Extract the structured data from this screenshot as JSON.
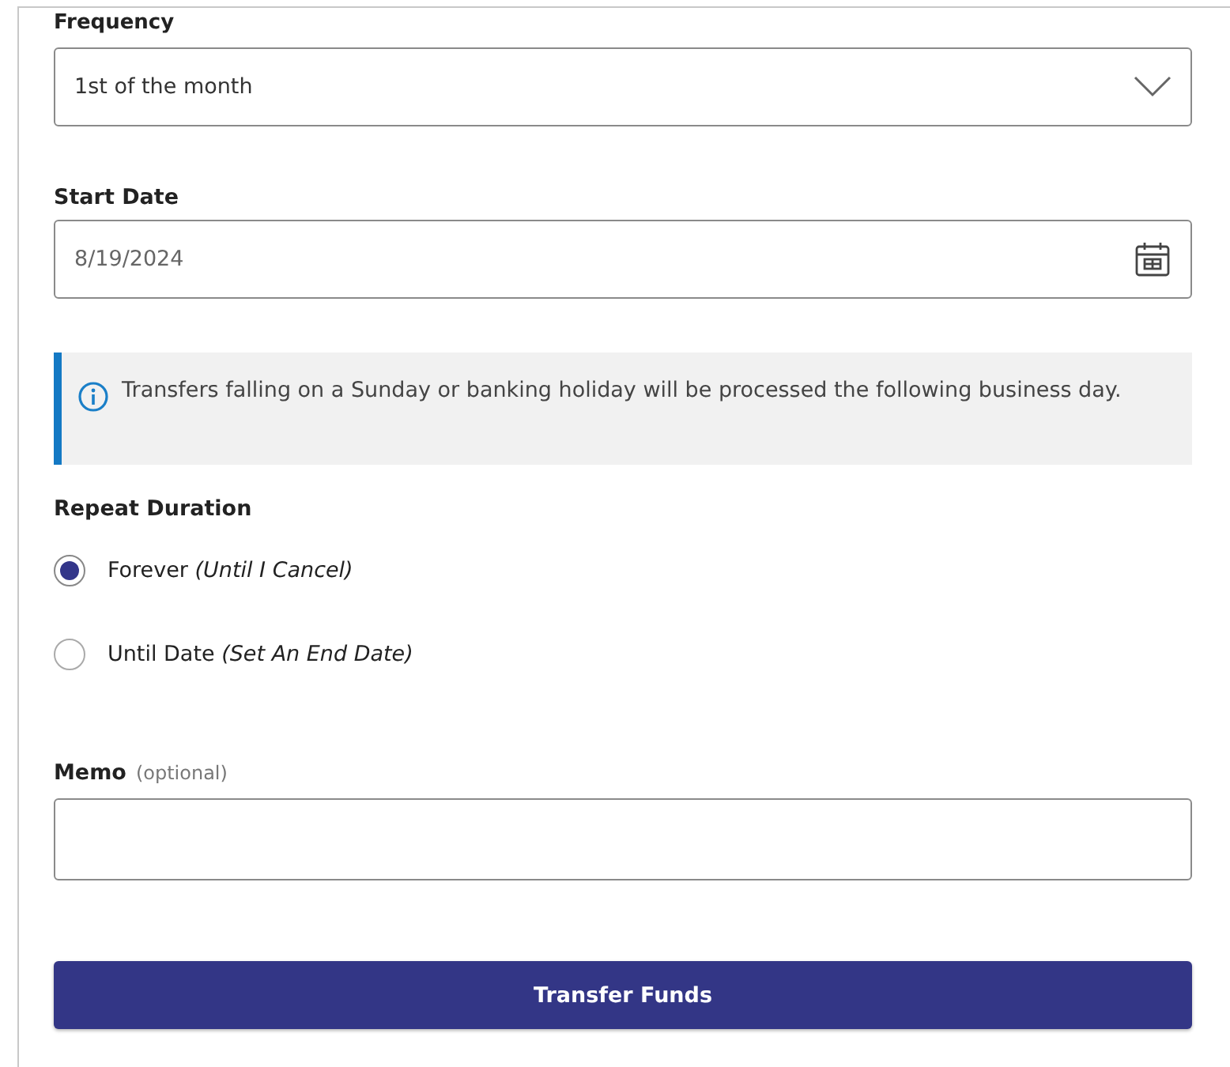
{
  "frequency": {
    "label": "Frequency",
    "value": "1st of the month"
  },
  "start_date": {
    "label": "Start Date",
    "value": "8/19/2024"
  },
  "notice": {
    "text": "Transfers falling on a Sunday or banking holiday will be processed the following business day."
  },
  "repeat_duration": {
    "label": "Repeat Duration",
    "options": [
      {
        "label": "Forever *(Until I Cancel)*",
        "selected": true
      },
      {
        "label": "Until Date *(Set An End Date)*",
        "selected": false
      }
    ]
  },
  "memo": {
    "label": "Memo",
    "hint": "(optional)"
  },
  "submit": {
    "label": "Transfer Funds"
  }
}
